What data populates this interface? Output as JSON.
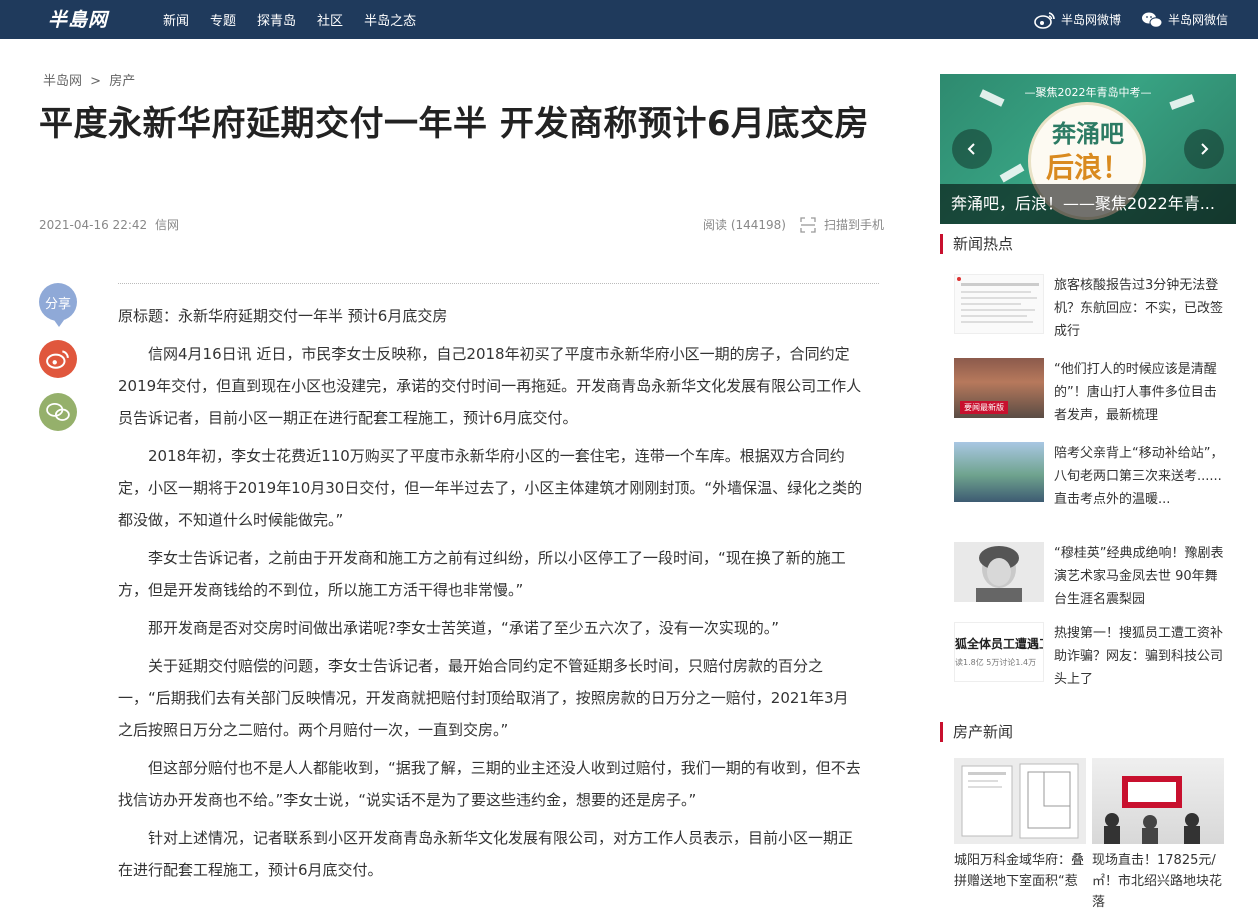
{
  "header": {
    "logo": "半島网",
    "nav": [
      "新闻",
      "专题",
      "探青岛",
      "社区",
      "半岛之态"
    ],
    "weibo_label": "半岛网微博",
    "wechat_label": "半岛网微信"
  },
  "breadcrumb": {
    "home": "半岛网",
    "sep": ">",
    "section": "房产"
  },
  "article": {
    "title": "平度永新华府延期交付一年半 开发商称预计6月底交房",
    "date": "2021-04-16 22:42",
    "source": "信网",
    "reads": "阅读 (144198)",
    "scan": "扫描到手机",
    "paragraphs": [
      "原标题：永新华府延期交付一年半 预计6月底交房",
      "信网4月16日讯 近日，市民李女士反映称，自己2018年初买了平度市永新华府小区一期的房子，合同约定2019年交付，但直到现在小区也没建完，承诺的交付时间一再拖延。开发商青岛永新华文化发展有限公司工作人员告诉记者，目前小区一期正在进行配套工程施工，预计6月底交付。",
      "2018年初，李女士花费近110万购买了平度市永新华府小区的一套住宅，连带一个车库。根据双方合同约定，小区一期将于2019年10月30日交付，但一年半过去了，小区主体建筑才刚刚封顶。“外墙保温、绿化之类的都没做，不知道什么时候能做完。”",
      "李女士告诉记者，之前由于开发商和施工方之前有过纠纷，所以小区停工了一段时间，“现在换了新的施工方，但是开发商钱给的不到位，所以施工方活干得也非常慢。”",
      "那开发商是否对交房时间做出承诺呢?李女士苦笑道，“承诺了至少五六次了，没有一次实现的。”",
      "关于延期交付赔偿的问题，李女士告诉记者，最开始合同约定不管延期多长时间，只赔付房款的百分之一，“后期我们去有关部门反映情况，开发商就把赔付封顶给取消了，按照房款的日万分之一赔付，2021年3月之后按照日万分之二赔付。两个月赔付一次，一直到交房。”",
      "但这部分赔付也不是人人都能收到，“据我了解，三期的业主还没人收到过赔付，我们一期的有收到，但不去找信访办开发商也不给。”李女士说，“说实话不是为了要这些违约金，想要的还是房子。”",
      "针对上述情况，记者联系到小区开发商青岛永新华文化发展有限公司，对方工作人员表示，目前小区一期正在进行配套工程施工，预计6月底交付。"
    ]
  },
  "share": {
    "label": "分享"
  },
  "slider": {
    "sub": "—聚焦2022年青岛中考—",
    "big1": "奔涌吧",
    "big2": "后浪！",
    "caption": "奔涌吧，后浪！——聚焦2022年青..."
  },
  "hot_news": {
    "title": "新闻热点",
    "items": [
      {
        "text": "旅客核酸报告过3分钟无法登机？东航回应：不实，已改签成行"
      },
      {
        "text": "“他们打人的时候应该是清醒的”！唐山打人事件多位目击者发声，最新梳理",
        "thumb_text": "要闻最新版"
      },
      {
        "text": "陪考父亲背上“移动补给站”，八旬老两口第三次来送考......直击考点外的温暖..."
      },
      {
        "text": "“穆桂英”经典成绝响！豫剧表演艺术家马金凤去世 90年舞台生涯名震梨园"
      },
      {
        "text": "热搜第一！搜狐员工遭工资补助诈骗？网友：骗到科技公司头上了",
        "thumb_text": "狐全体员工遭遇工",
        "thumb_sub": "读1.8亿  5万讨论1.4万"
      }
    ]
  },
  "house_news": {
    "title": "房产新闻",
    "items": [
      {
        "caption": "城阳万科金域华府：叠拼赠送地下室面积“惹"
      },
      {
        "caption": "现场直击！17825元/㎡！市北绍兴路地块花落"
      }
    ]
  },
  "colors": {
    "header_bg": "#1f3a5c",
    "accent": "#c8102e",
    "share_blue": "#8fa9d7",
    "weibo_red": "#e0573d",
    "wechat_green": "#95b06b"
  }
}
